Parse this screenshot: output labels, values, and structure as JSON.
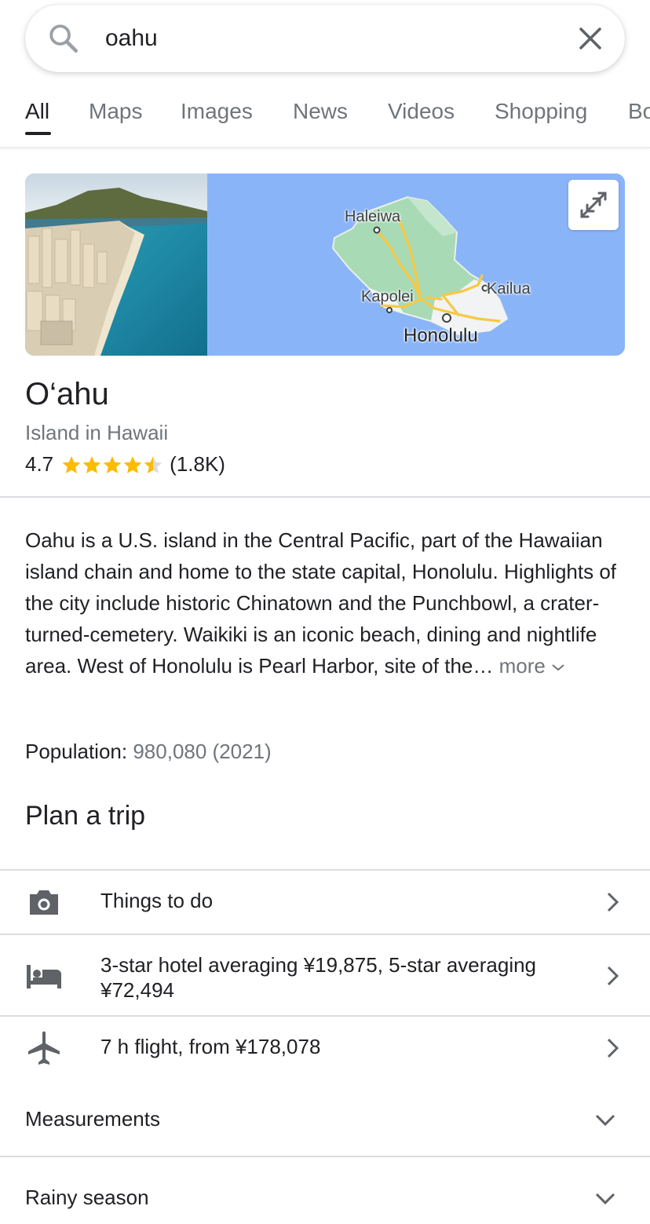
{
  "search": {
    "query": "oahu"
  },
  "tabs": [
    {
      "label": "All",
      "active": true
    },
    {
      "label": "Maps"
    },
    {
      "label": "Images"
    },
    {
      "label": "News"
    },
    {
      "label": "Videos"
    },
    {
      "label": "Shopping"
    },
    {
      "label": "Bo"
    }
  ],
  "map": {
    "labels": {
      "haleiwa": "Haleiwa",
      "kailua": "Kailua",
      "kapolei": "Kapolei",
      "honolulu": "Honolulu"
    }
  },
  "place": {
    "title": "O‘ahu",
    "subtitle": "Island in Hawaii",
    "rating": "4.7",
    "rating_value": 4.7,
    "review_count": "(1.8K)"
  },
  "description": {
    "text": "Oahu is a U.S. island in the Central Pacific, part of the Hawaiian island chain and home to the state capital, Honolulu. Highlights of the city include historic Chinatown and the Punchbowl, a crater-turned-cemetery. Waikiki is an iconic beach, dining and nightlife area. West of Honolulu is Pearl Harbor, site of the…",
    "more": "more"
  },
  "population": {
    "label": "Population:",
    "value": "980,080 (2021)"
  },
  "plan": {
    "title": "Plan a trip",
    "rows": [
      {
        "icon": "camera-icon",
        "text": "Things to do"
      },
      {
        "icon": "bed-icon",
        "text": "3-star hotel averaging ¥19,875, 5-star averaging ¥72,494"
      },
      {
        "icon": "airplane-icon",
        "text": "7 h flight, from ¥178,078"
      }
    ]
  },
  "accordions": [
    {
      "label": "Measurements"
    },
    {
      "label": "Rainy season"
    }
  ],
  "colors": {
    "star": "#fbbc04",
    "map_water": "#8ab4f8",
    "map_land": "#a8dab5",
    "road": "#fdd663"
  }
}
